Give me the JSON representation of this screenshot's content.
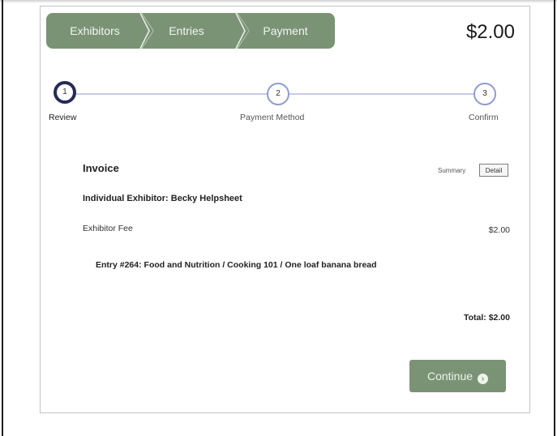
{
  "header": {
    "breadcrumbs": [
      "Exhibitors",
      "Entries",
      "Payment"
    ],
    "price": "$2.00"
  },
  "progress": {
    "steps": [
      {
        "number": "1",
        "label": "Review",
        "active": true
      },
      {
        "number": "2",
        "label": "Payment Method",
        "active": false
      },
      {
        "number": "3",
        "label": "Confirm",
        "active": false
      }
    ]
  },
  "invoice": {
    "title": "Invoice",
    "view_toggle": {
      "summary": "Summary",
      "detail": "Detail",
      "selected": "Detail"
    },
    "exhibitor": "Individual Exhibitor: Becky Helpsheet",
    "fee_label": "Exhibitor Fee",
    "fee_amount": "$2.00",
    "entry": "Entry #264: Food and Nutrition / Cooking 101 / One loaf banana bread",
    "total": "Total: $2.00"
  },
  "actions": {
    "continue_label": "Continue"
  },
  "colors": {
    "accent_green": "#7a9375",
    "active_step": "#262a55",
    "step_ring": "#8f9bd3"
  }
}
